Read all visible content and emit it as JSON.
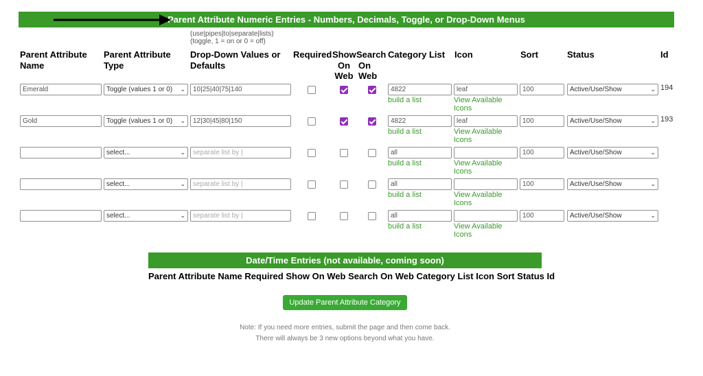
{
  "numeric_banner": {
    "title": "Parent Attribute Numeric Entries - Numbers, Decimals, Toggle, or Drop-Down Menus"
  },
  "hint": {
    "line1": "(use|pipes|to|separate|lists)",
    "line2": "(toggle, 1 = on or 0 = off)"
  },
  "headers": {
    "name_line1": "Parent Attribute",
    "name_line2": "Name",
    "type_line1": "Parent Attribute",
    "type_line2": "Type",
    "values_line1": "Drop-Down Values or",
    "values_line2": "Defaults",
    "required": "Required",
    "show_line1": "Show",
    "show_line2": "On",
    "show_line3": "Web",
    "search_line1": "Search",
    "search_line2": "On",
    "search_line3": "Web",
    "category": "Category List",
    "icon": "Icon",
    "sort": "Sort",
    "status": "Status",
    "id": "Id"
  },
  "rows": [
    {
      "name": "Emerald",
      "name_placeholder": "",
      "type": "Toggle (values 1 or 0)",
      "values": "10|25|40|75|140",
      "values_placeholder": "",
      "required": false,
      "show_on_web": true,
      "search_on_web": true,
      "category": "4822",
      "build_link": "build a list",
      "icon": "leaf",
      "icons_link_1": "View Available",
      "icons_link_2": "Icons",
      "sort": "100",
      "status": "Active/Use/Show",
      "id": "194"
    },
    {
      "name": "Gold",
      "name_placeholder": "",
      "type": "Toggle (values 1 or 0)",
      "values": "12|30|45|80|150",
      "values_placeholder": "",
      "required": false,
      "show_on_web": true,
      "search_on_web": true,
      "category": "4822",
      "build_link": "build a list",
      "icon": "leaf",
      "icons_link_1": "View Available",
      "icons_link_2": "Icons",
      "sort": "100",
      "status": "Active/Use/Show",
      "id": "193"
    },
    {
      "name": "",
      "type": "select...",
      "values": "",
      "values_placeholder": "separate list by |",
      "required": false,
      "show_on_web": false,
      "search_on_web": false,
      "category": "all",
      "build_link": "build a list",
      "icon": "",
      "icons_link_1": "View Available",
      "icons_link_2": "Icons",
      "sort": "100",
      "status": "Active/Use/Show",
      "id": ""
    },
    {
      "name": "",
      "type": "select...",
      "values": "",
      "values_placeholder": "separate list by |",
      "required": false,
      "show_on_web": false,
      "search_on_web": false,
      "category": "all",
      "build_link": "build a list",
      "icon": "",
      "icons_link_1": "View Available",
      "icons_link_2": "Icons",
      "sort": "100",
      "status": "Active/Use/Show",
      "id": ""
    },
    {
      "name": "",
      "type": "select...",
      "values": "",
      "values_placeholder": "separate list by |",
      "required": false,
      "show_on_web": false,
      "search_on_web": false,
      "category": "all",
      "build_link": "build a list",
      "icon": "",
      "icons_link_1": "View Available",
      "icons_link_2": "Icons",
      "sort": "100",
      "status": "Active/Use/Show",
      "id": ""
    }
  ],
  "datetime_banner": {
    "title": "Date/Time Entries (not available, coming soon)"
  },
  "datetime_headers": "Parent Attribute Name Required Show On Web Search On Web Category List Icon Sort Status Id",
  "update_button": "Update Parent Attribute Category",
  "note": {
    "line1": "Note: If you need more entries, submit the page and then come back.",
    "line2": "There will always be 3 new options beyond what you have."
  },
  "colors": {
    "banner": "#3a9a2a",
    "link": "#3a9a2a",
    "checkbox_checked": "#8e2fb8"
  }
}
